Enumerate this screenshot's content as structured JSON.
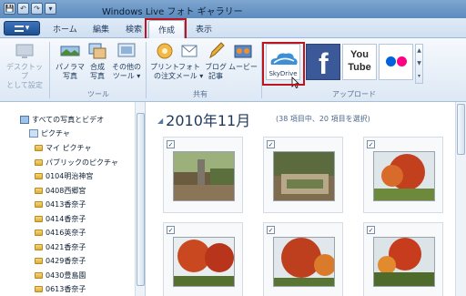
{
  "window": {
    "title": "Windows Live フォト ギャラリー"
  },
  "quick_access": [
    "💾",
    "↶",
    "↷",
    "▾"
  ],
  "file_button": {
    "icon": "menu-icon",
    "label": "▾"
  },
  "tabs": [
    {
      "label": "ホーム"
    },
    {
      "label": "編集"
    },
    {
      "label": "検索"
    },
    {
      "label": "作成"
    },
    {
      "label": "表示"
    }
  ],
  "ribbon": {
    "desktop_background": "デスクトップ\nとして設定",
    "tools": [
      {
        "label": "パノラマ\n写真"
      },
      {
        "label": "合成\n写真"
      },
      {
        "label": "その他の\nツール ▾"
      }
    ],
    "tools_group_label": "ツール",
    "share": [
      {
        "label": "プリント\nの注文"
      },
      {
        "label": "フォト\nメール ▾"
      },
      {
        "label": "ブログ\n記事"
      },
      {
        "label": "ムービー"
      }
    ],
    "share_group_label": "共有",
    "upload_services": [
      {
        "name": "SkyDrive",
        "label": "SkyDrive"
      },
      {
        "name": "facebook",
        "label": "f"
      },
      {
        "name": "youtube",
        "label": "You\nTube"
      },
      {
        "name": "flickr",
        "label": "flickr"
      }
    ],
    "upload_group_label": "アップロード"
  },
  "sidebar": {
    "root": "すべての写真とビデオ",
    "pictures": "ピクチャ",
    "folders": [
      "マイ ピクチャ",
      "パブリックのピクチャ",
      "0104明治神宮",
      "0408西郷宮",
      "0413香奈子",
      "0414香奈子",
      "0416英奈子",
      "0421香奈子",
      "0429香奈子",
      "0430豊島園",
      "0613香奈子",
      "0614ふれあいサンデー"
    ]
  },
  "main": {
    "date_heading": "2010年11月",
    "item_count": "(38 項目中、20 項目を選択)",
    "check_mark": "✓"
  },
  "colors": {
    "accent": "#c0141c",
    "ribbon": "#dde8f5",
    "facebook": "#3b5998",
    "youtube_red": "#e62117",
    "flickr_blue": "#0063dc",
    "flickr_pink": "#ff0084"
  }
}
